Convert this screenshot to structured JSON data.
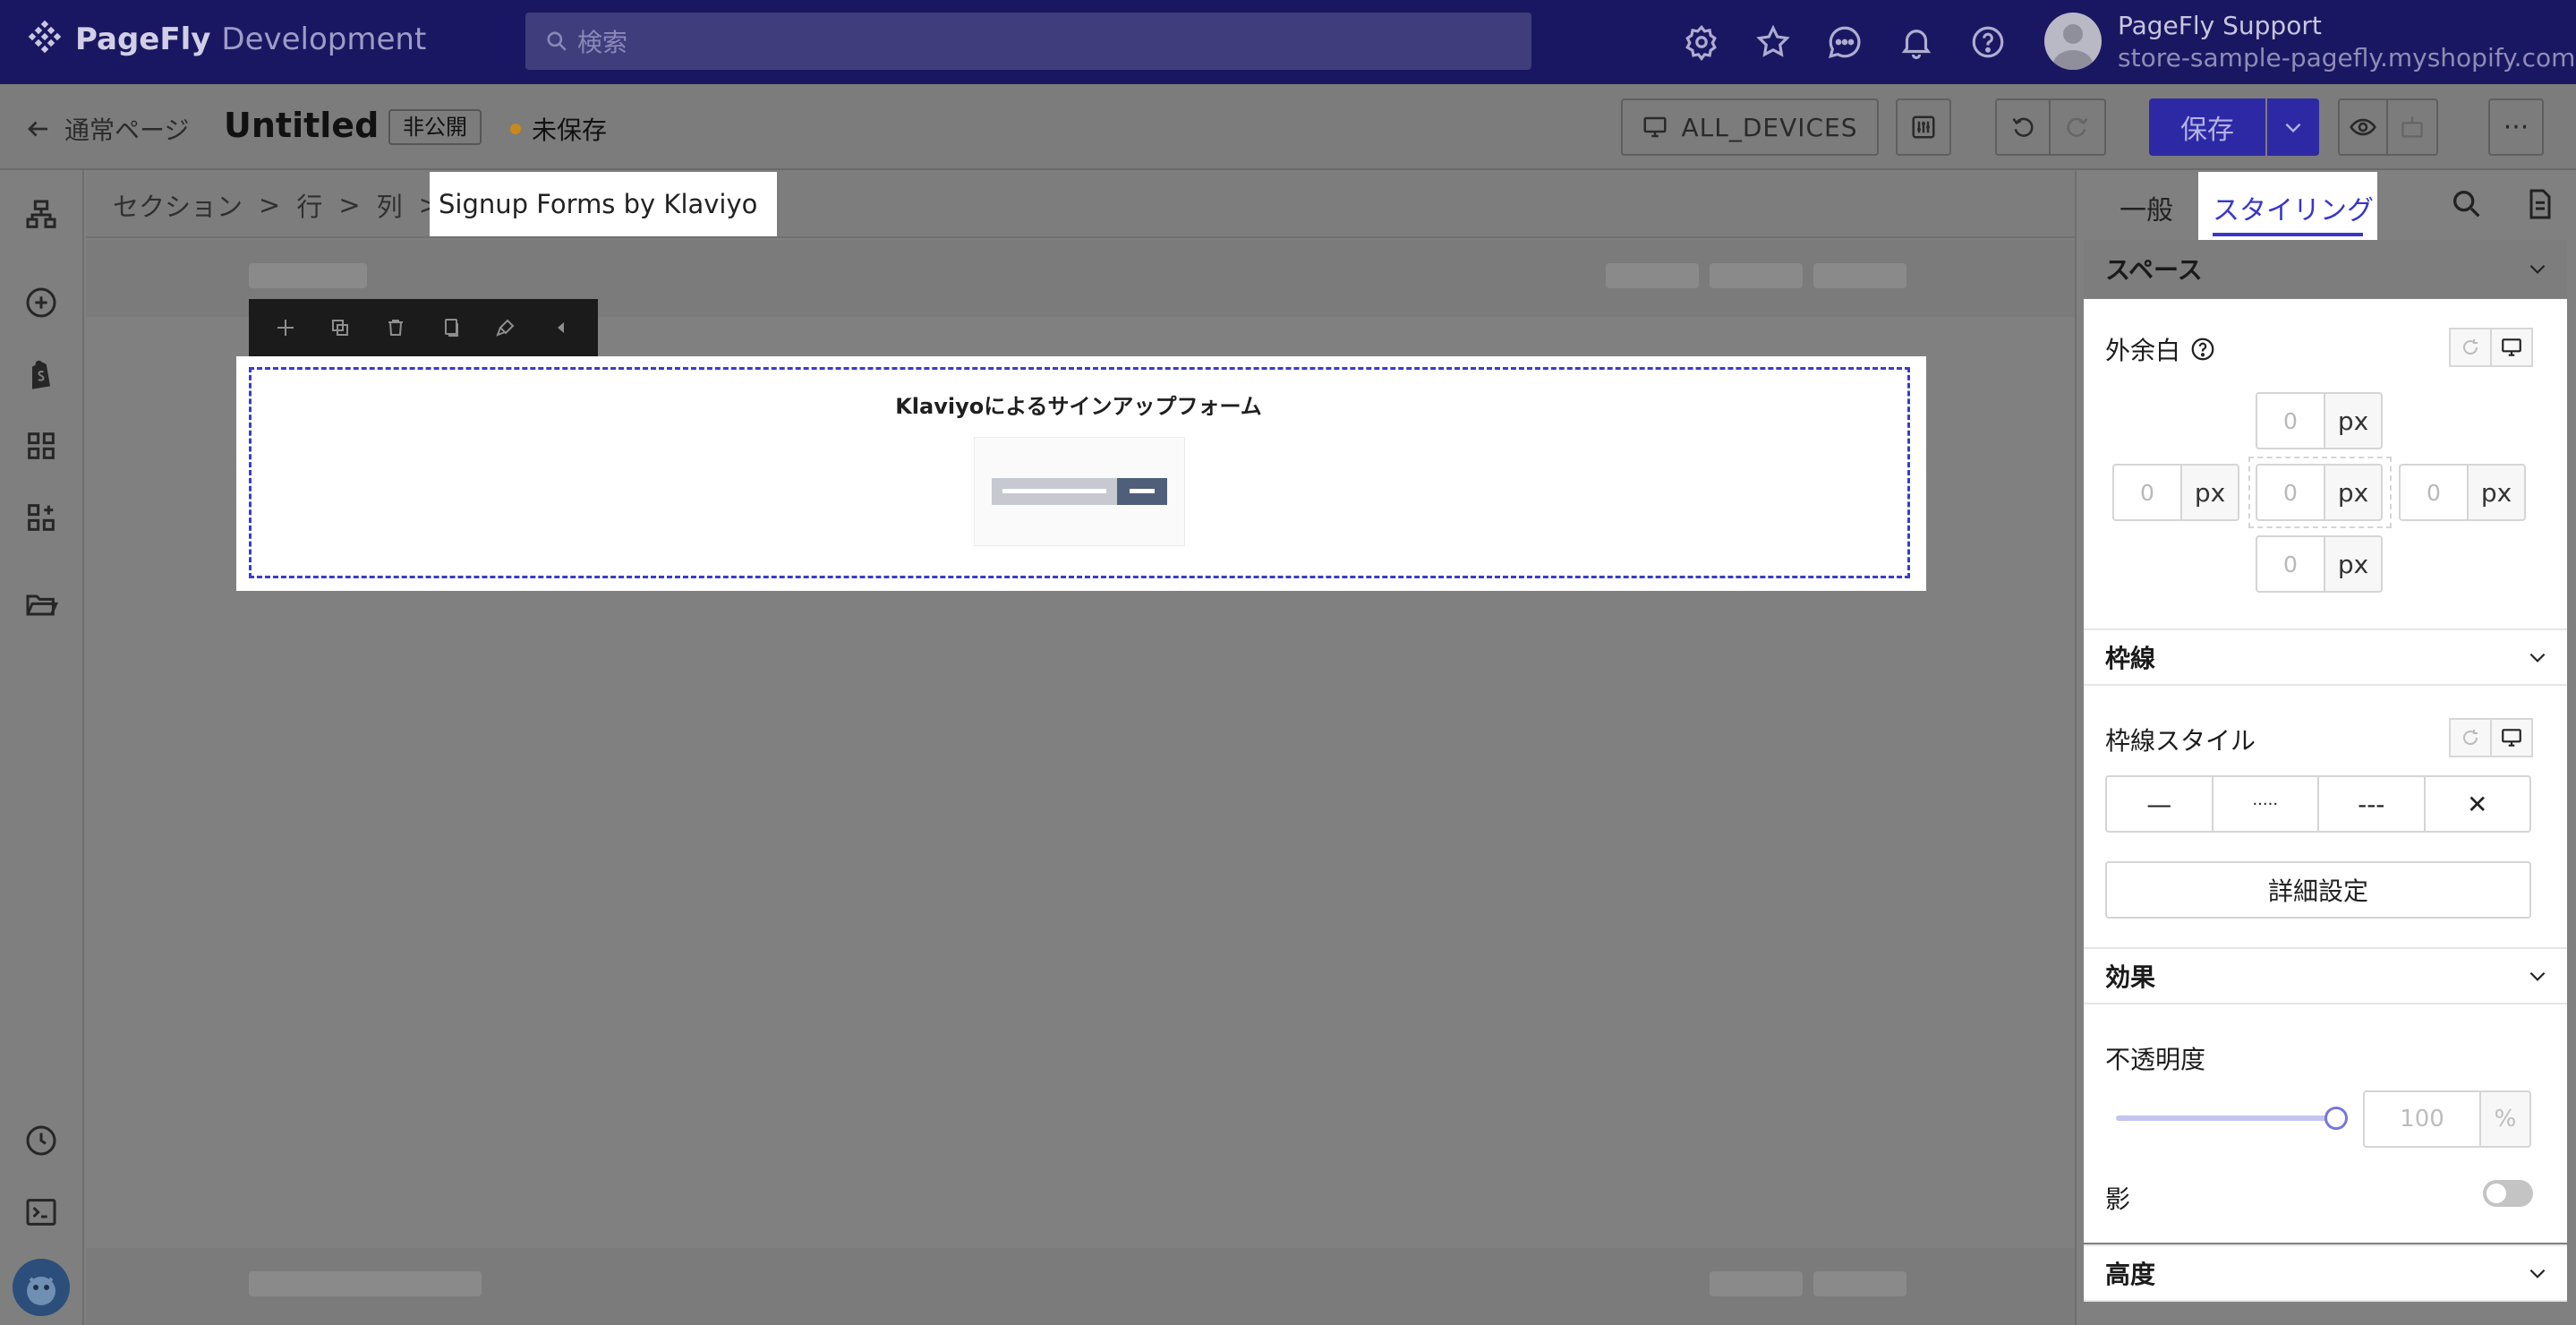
{
  "app": {
    "brand": "PageFly",
    "environment": "Development",
    "search_placeholder": "検索",
    "user": {
      "name": "PageFly Support",
      "store": "store-sample-pagefly.myshopify.com"
    }
  },
  "header": {
    "back_label": "通常ページ",
    "page_title": "Untitled",
    "visibility_badge": "非公開",
    "save_status": "未保存",
    "device_label": "ALL_DEVICES",
    "save_label": "保存",
    "more_label": "···"
  },
  "breadcrumb": {
    "items": [
      "セクション",
      "行",
      "列"
    ],
    "separator": ">",
    "active": "Signup Forms by Klaviyo"
  },
  "canvas": {
    "element_title": "Klaviyoによるサインアップフォーム"
  },
  "right_panel": {
    "tabs": {
      "general": "一般",
      "styling": "スタイリング"
    },
    "sections": {
      "space": {
        "title": "スペース",
        "margin_label": "外余白",
        "unit": "px",
        "margin": {
          "top": "0",
          "left": "0",
          "center": "0",
          "right": "0",
          "bottom": "0"
        }
      },
      "border": {
        "title": "枠線",
        "style_label": "枠線スタイル",
        "styles": [
          "—",
          "·····",
          "---",
          "✕"
        ],
        "advanced_label": "詳細設定"
      },
      "effects": {
        "title": "効果",
        "opacity_label": "不透明度",
        "opacity_value": "100",
        "opacity_unit": "%",
        "opacity_fraction": 1.0,
        "shadow_label": "影",
        "shadow_enabled": false
      },
      "height": {
        "title": "高度"
      }
    }
  },
  "colors": {
    "topbar": "#1a1762",
    "accent": "#3936c9",
    "save_button": "#2d29a5",
    "unsaved_dot": "#c88a1a"
  }
}
